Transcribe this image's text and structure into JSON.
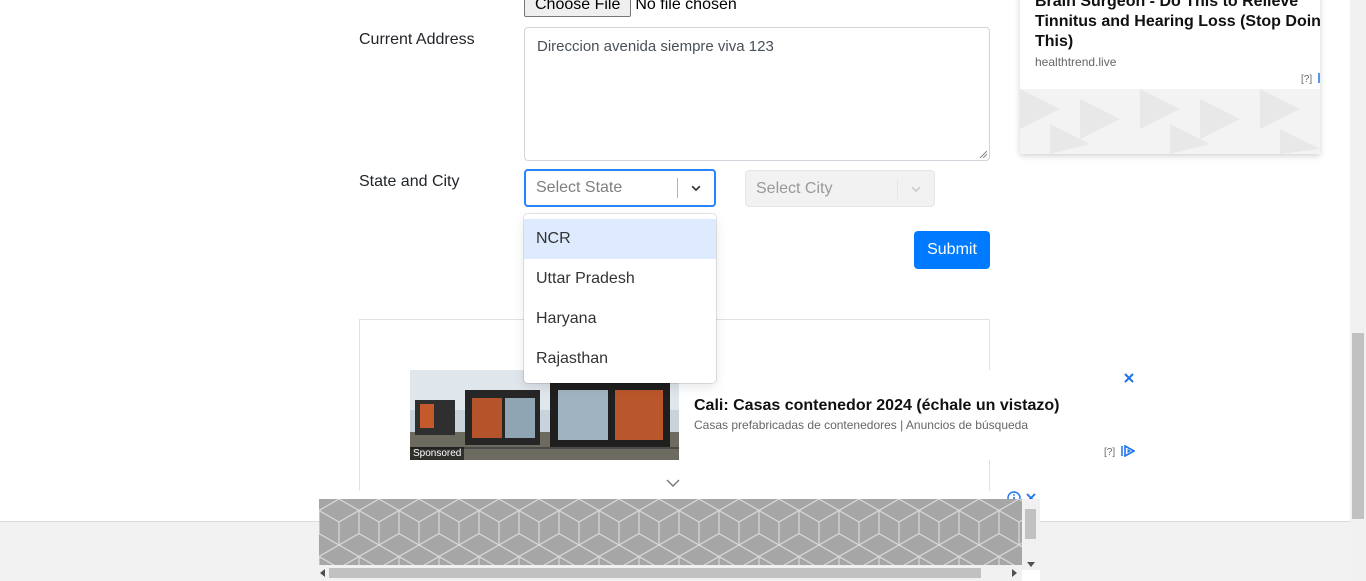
{
  "form": {
    "file_button_label": "Choose File",
    "file_status": "No file chosen",
    "address_label": "Current Address",
    "address_value": "Direccion avenida siempre viva 123",
    "state_city_label": "State and City",
    "state_placeholder": "Select State",
    "city_placeholder": "Select City",
    "submit_label": "Submit",
    "state_options": [
      "NCR",
      "Uttar Pradesh",
      "Haryana",
      "Rajasthan"
    ],
    "highlighted_option": "NCR"
  },
  "ad_top": {
    "title": "Brain Surgeon - Do This to Relieve Tinnitus and Hearing Loss (Stop Doing This)",
    "domain": "healthtrend.live",
    "info_marker": "[?]"
  },
  "ad_middle": {
    "badge": "Sponsored",
    "title": "Cali: Casas contenedor 2024 (échale un vistazo)",
    "subtitle": "Casas prefabricadas de contenedores | Anuncios de búsqueda",
    "info_marker": "[?]"
  },
  "colors": {
    "primary": "#007bff",
    "focus_border": "#2684ff",
    "option_highlight": "#deebff",
    "ad_close": "#1a73e8"
  }
}
